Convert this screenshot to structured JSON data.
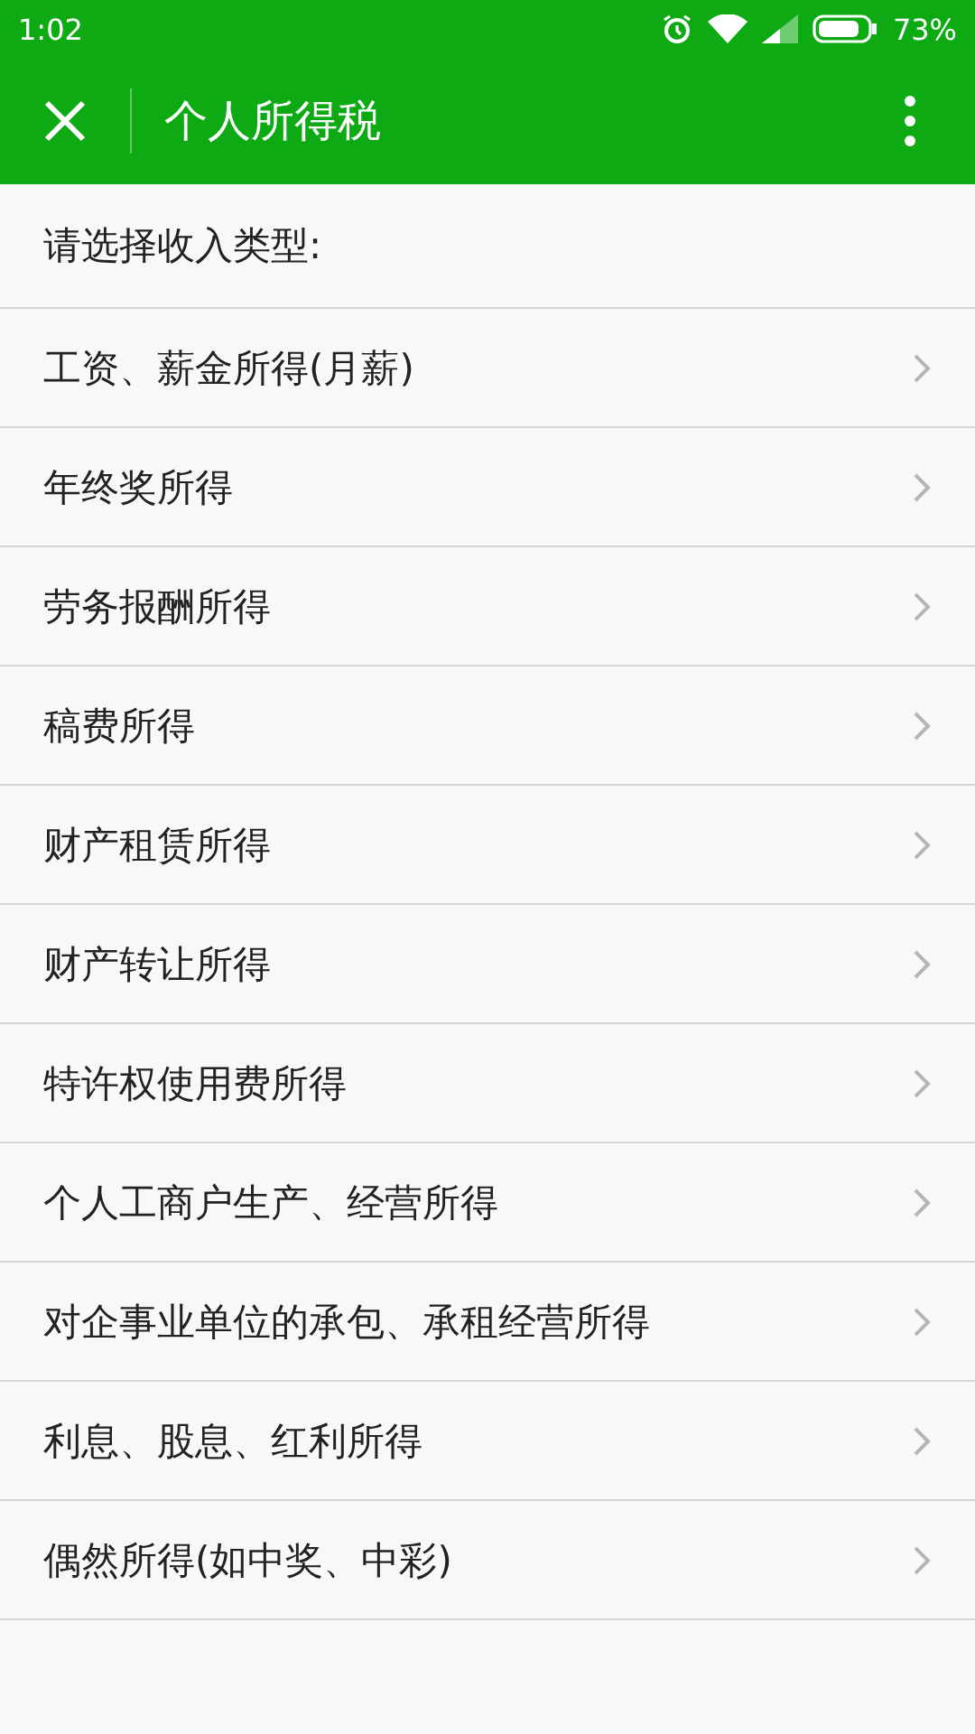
{
  "status_bar": {
    "time": "1:02",
    "battery": "73%"
  },
  "header": {
    "title": "个人所得税"
  },
  "prompt": "请选择收入类型:",
  "items": [
    {
      "label": "工资、薪金所得(月薪)"
    },
    {
      "label": "年终奖所得"
    },
    {
      "label": "劳务报酬所得"
    },
    {
      "label": "稿费所得"
    },
    {
      "label": "财产租赁所得"
    },
    {
      "label": "财产转让所得"
    },
    {
      "label": "特许权使用费所得"
    },
    {
      "label": "个人工商户生产、经营所得"
    },
    {
      "label": "对企事业单位的承包、承租经营所得"
    },
    {
      "label": "利息、股息、红利所得"
    },
    {
      "label": "偶然所得(如中奖、中彩)"
    }
  ]
}
